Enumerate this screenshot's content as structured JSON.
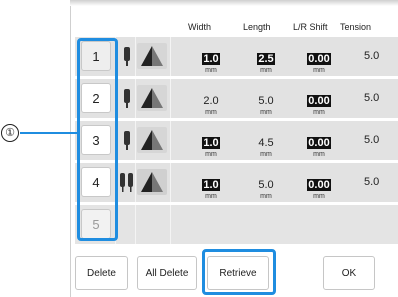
{
  "callout": "①",
  "headers": {
    "width": "Width",
    "length": "Length",
    "lr_shift": "L/R Shift",
    "tension": "Tension"
  },
  "rows": [
    {
      "num": "1",
      "width": "1.0",
      "width_unit": "mm",
      "length": "2.5",
      "length_unit": "mm",
      "shift": "0.00",
      "shift_unit": "mm",
      "tension": "5.0"
    },
    {
      "num": "2",
      "width": "2.0",
      "width_unit": "mm",
      "length": "5.0",
      "length_unit": "mm",
      "shift": "0.00",
      "shift_unit": "mm",
      "tension": "5.0"
    },
    {
      "num": "3",
      "width": "1.0",
      "width_unit": "mm",
      "length": "4.5",
      "length_unit": "mm",
      "shift": "0.00",
      "shift_unit": "mm",
      "tension": "5.0"
    },
    {
      "num": "4",
      "width": "1.0",
      "width_unit": "mm",
      "length": "5.0",
      "length_unit": "mm",
      "shift": "0.00",
      "shift_unit": "mm",
      "tension": "5.0"
    },
    {
      "num": "5"
    }
  ],
  "buttons": {
    "delete": "Delete",
    "all_delete": "All Delete",
    "retrieve": "Retrieve",
    "ok": "OK"
  },
  "colors": {
    "highlight": "#1f8de0",
    "row_bg": "#e2e2e2"
  }
}
